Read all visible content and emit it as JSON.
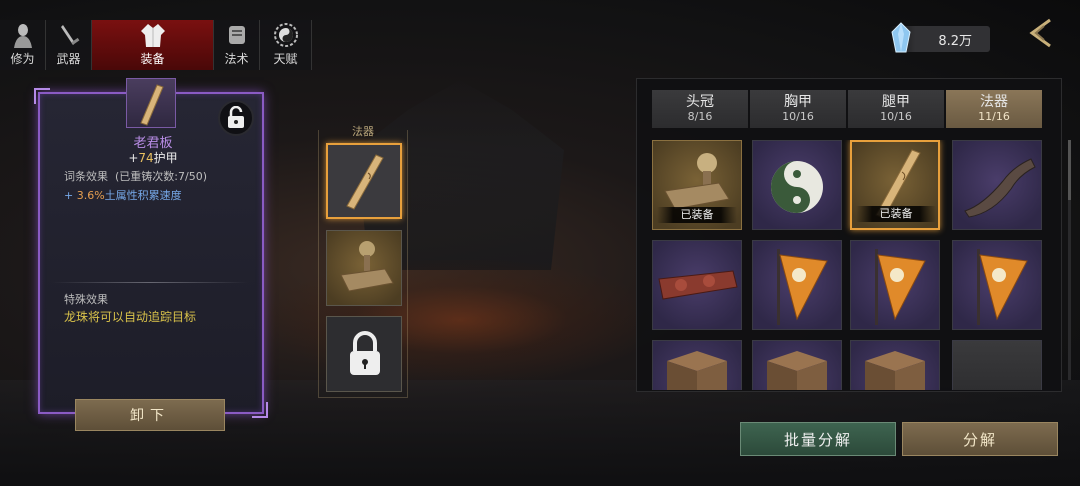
{
  "top_tabs": [
    {
      "label": "修为",
      "icon": "cultivation-figure-icon"
    },
    {
      "label": "武器",
      "icon": "sword-icon"
    },
    {
      "label": "装备",
      "icon": "robe-icon",
      "active": true
    },
    {
      "label": "法术",
      "icon": "scroll-icon"
    },
    {
      "label": "天赋",
      "icon": "yin-yang-icon"
    }
  ],
  "currency": {
    "value": "8.2万",
    "icon": "crystal-icon"
  },
  "detail": {
    "name": "老君板",
    "stat_prefix": "+",
    "stat_value": "74",
    "stat_label": "护甲",
    "affix_title": "词条效果",
    "affix_recast": "(已重铸次数:7/50)",
    "affix_prefix": "+ ",
    "affix_pct": "3.6%",
    "affix_text": "土属性积累速度",
    "special_title": "特殊效果",
    "special_text": "龙珠将可以自动追踪目标",
    "unequip_label": "卸下"
  },
  "slots": {
    "label": "法器",
    "items": [
      {
        "name": "老君板",
        "selected": true
      },
      {
        "name": "印章"
      },
      {
        "name": "未解锁",
        "locked": true
      }
    ]
  },
  "inventory": {
    "tabs": [
      {
        "label": "头冠",
        "count": "8/16"
      },
      {
        "label": "胸甲",
        "count": "10/16"
      },
      {
        "label": "腿甲",
        "count": "10/16"
      },
      {
        "label": "法器",
        "count": "11/16",
        "active": true
      }
    ],
    "equipped_label": "已装备",
    "items": [
      {
        "kind": "seal",
        "rarity": "gold",
        "equipped": true
      },
      {
        "kind": "yinyang-orb",
        "rarity": "purple"
      },
      {
        "kind": "board",
        "rarity": "gold",
        "equipped": true,
        "selected": true
      },
      {
        "kind": "horn",
        "rarity": "purple"
      },
      {
        "kind": "carved-beam",
        "rarity": "purple"
      },
      {
        "kind": "bagua-flag",
        "rarity": "purple"
      },
      {
        "kind": "bagua-flag",
        "rarity": "purple"
      },
      {
        "kind": "bagua-flag",
        "rarity": "purple"
      },
      {
        "kind": "rune-box",
        "rarity": "purple"
      },
      {
        "kind": "rune-box",
        "rarity": "purple"
      },
      {
        "kind": "rune-box",
        "rarity": "purple"
      },
      {
        "kind": "empty",
        "rarity": "grey"
      }
    ]
  },
  "buttons": {
    "batch_decompose": "批量分解",
    "decompose": "分解"
  },
  "colors": {
    "accent_purple": "#8a5bc4",
    "selection_orange": "#e8a03c",
    "tab_active_red": "#7a1010",
    "affix_blue": "#76a8e8",
    "special_yellow": "#d9c24a"
  }
}
